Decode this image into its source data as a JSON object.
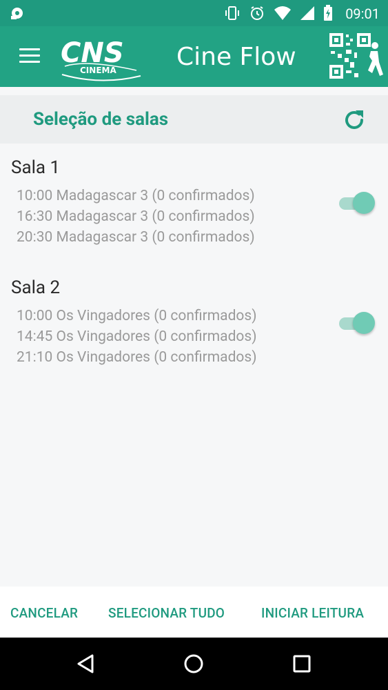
{
  "status_bar": {
    "time": "09:01",
    "icons": [
      "notification-icon",
      "vibrate-icon",
      "alarm-icon",
      "wifi-icon",
      "signal-icon",
      "battery-charging-icon"
    ]
  },
  "app_bar": {
    "title": "Cine Flow",
    "logo_text": "CNS",
    "logo_subtext": "CINEMA",
    "menu_icon": "hamburger-icon",
    "scan_icon": "qr-walk-icon"
  },
  "section": {
    "title": "Seleção de salas",
    "refresh_icon": "refresh-icon"
  },
  "rooms": [
    {
      "title": "Sala 1",
      "selected": true,
      "sessions": [
        "10:00 Madagascar 3 (0 confirmados)",
        "16:30 Madagascar 3 (0 confirmados)",
        "20:30 Madagascar 3 (0 confirmados)"
      ]
    },
    {
      "title": "Sala 2",
      "selected": true,
      "sessions": [
        "10:00 Os Vingadores (0 confirmados)",
        "14:45 Os Vingadores (0 confirmados)",
        "21:10 Os Vingadores (0 confirmados)"
      ]
    }
  ],
  "actions": {
    "cancel": "CANCELAR",
    "select_all": "SELECIONAR TUDO",
    "start_reading": "INICIAR LEITURA"
  },
  "colors": {
    "primary": "#22a384",
    "primary_dark": "#1f9a7f",
    "accent_toggle": "#70cbb5"
  }
}
